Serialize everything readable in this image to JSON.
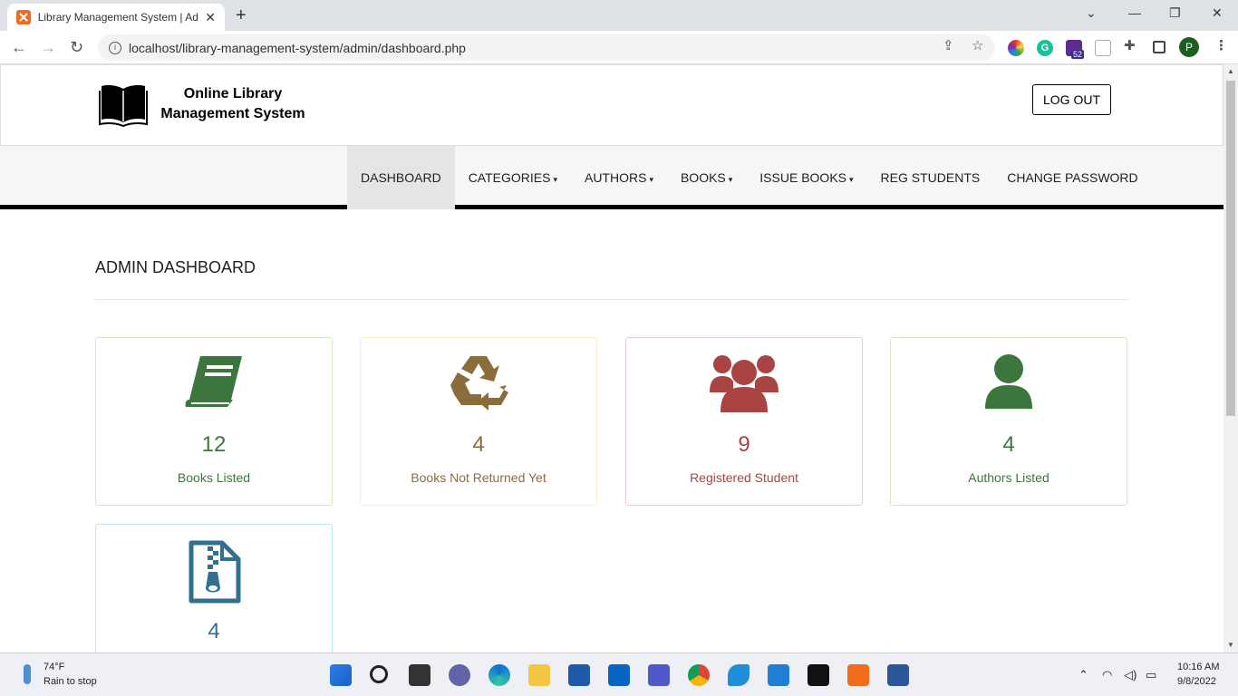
{
  "browser": {
    "tab_title": "Library Management System | Ad",
    "url": "localhost/library-management-system/admin/dashboard.php",
    "extension_badge": "52",
    "profile_initial": "P"
  },
  "header": {
    "logo_line1": "Online Library",
    "logo_line2": "Management System",
    "logout_label": "LOG OUT"
  },
  "menu": {
    "items": [
      {
        "label": "DASHBOARD",
        "dropdown": false,
        "active": true
      },
      {
        "label": "CATEGORIES",
        "dropdown": true
      },
      {
        "label": "AUTHORS",
        "dropdown": true
      },
      {
        "label": "BOOKS",
        "dropdown": true
      },
      {
        "label": "ISSUE BOOKS",
        "dropdown": true
      },
      {
        "label": "REG STUDENTS",
        "dropdown": false
      },
      {
        "label": "CHANGE PASSWORD",
        "dropdown": false
      }
    ]
  },
  "dashboard": {
    "title": "ADMIN DASHBOARD",
    "cards": [
      {
        "count": "12",
        "label": "Books Listed",
        "icon": "book-icon",
        "color": "#3c763d",
        "border": "#d6e9c6"
      },
      {
        "count": "4",
        "label": "Books Not Returned Yet",
        "icon": "recycle-icon",
        "color": "#8a6d3b",
        "border": "#faebcc"
      },
      {
        "count": "9",
        "label": "Registered Student",
        "icon": "users-icon",
        "color": "#a94442",
        "border": "#ebccd1"
      },
      {
        "count": "4",
        "label": "Authors Listed",
        "icon": "user-icon",
        "color": "#3c763d",
        "border": "#d6e9c6"
      },
      {
        "count": "4",
        "label": "",
        "icon": "file-archive-icon",
        "color": "#31708f",
        "border": "#bce8f1"
      }
    ]
  },
  "taskbar": {
    "temperature": "74°F",
    "weather": "Rain to stop",
    "time": "10:16 AM",
    "date": "9/8/2022"
  }
}
